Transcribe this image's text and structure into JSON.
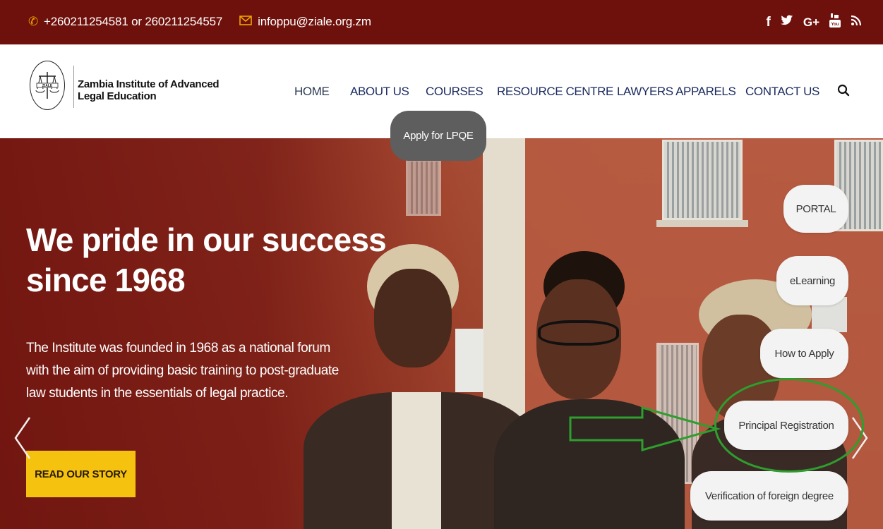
{
  "topbar": {
    "phone": "+260211254581 or 260211254557",
    "email": "infoppu@ziale.org.zm",
    "phone_icon": "phone-icon",
    "email_icon": "envelope-icon",
    "social": [
      {
        "name": "facebook-icon",
        "glyph": "f"
      },
      {
        "name": "twitter-icon",
        "glyph": "🐦"
      },
      {
        "name": "google-plus-icon",
        "glyph": "G+"
      },
      {
        "name": "youtube-icon",
        "glyph": "▣"
      },
      {
        "name": "rss-icon",
        "glyph": "⋋"
      }
    ]
  },
  "header": {
    "logo_line1": "Zambia Institute of Advanced",
    "logo_line2": "Legal Education",
    "logo_mark": "ZIALE",
    "nav": {
      "home": "HOME",
      "about": "ABOUT US",
      "courses": "COURSES",
      "resource": "RESOURCE CENTRE",
      "apparels": "LAWYERS APPARELS",
      "contact": "CONTACT US"
    },
    "apply_bubble": "Apply for LPQE"
  },
  "hero": {
    "title_line1": "We pride in our success",
    "title_line2": "since 1968",
    "text": "The Institute was founded in 1968 as a national forum with the aim of providing basic training to post-graduate law students in the essentials of legal practice.",
    "cta": "READ OUR STORY"
  },
  "side_links": {
    "portal": "PORTAL",
    "elearning": "eLearning",
    "how_to_apply": "How to Apply",
    "principal_registration": "Principal Registration",
    "verification": "Verification of foreign degree"
  },
  "colors": {
    "topbar": "#6e100b",
    "nav_text": "#1a2a5e",
    "cta": "#f5c30f",
    "annotation": "#2e9e2e",
    "icon_accent": "#f0a500"
  }
}
